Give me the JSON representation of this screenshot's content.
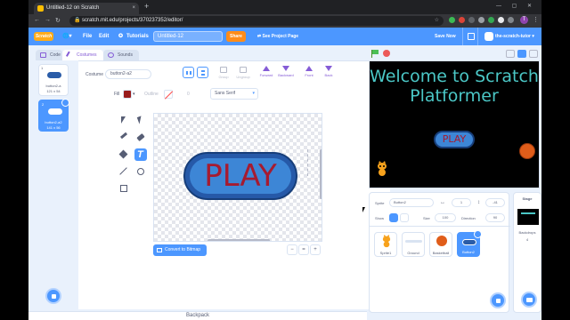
{
  "browser": {
    "tab_title": "Untitled-12 on Scratch",
    "tab_close": "×",
    "new_tab": "+",
    "url": "scratch.mit.edu/projects/370237352/editor/",
    "profile_initial": "T"
  },
  "menubar": {
    "logo": "Scratch",
    "file": "File",
    "edit": "Edit",
    "tutorials": "Tutorials",
    "project_title": "Untitled-12",
    "share": "Share",
    "see_project_page": "See Project Page",
    "save_now": "Save Now",
    "username": "the-scratch-tutor"
  },
  "editor_tabs": {
    "code": "Code",
    "costumes": "Costumes",
    "sounds": "Sounds"
  },
  "costumes": [
    {
      "number": "1",
      "name": "button2-a",
      "size": "121 x 54"
    },
    {
      "number": "2",
      "name": "button2-a2",
      "size": "141 x 56"
    }
  ],
  "paint": {
    "costume_label": "Costume",
    "costume_name": "button2-a2",
    "tools_top": [
      {
        "label": "Group"
      },
      {
        "label": "Ungroup"
      },
      {
        "label": "Forward"
      },
      {
        "label": "Backward"
      },
      {
        "label": "Front"
      },
      {
        "label": "Back"
      }
    ],
    "fill_label": "Fill",
    "fill_color": "#991c1c",
    "outline_label": "Outline",
    "outline_value": "0",
    "font": "Sans Serif",
    "canvas_text": "PLAY",
    "convert_button": "Convert to Bitmap",
    "zoom_out": "−",
    "zoom_reset": "=",
    "zoom_in": "+"
  },
  "stage": {
    "title_line1": "Welcome to Scratch",
    "title_line2": "Platformer",
    "play_label": "PLAY",
    "title_color": "#4bc7c6"
  },
  "sprite_info": {
    "sprite_label": "Sprite",
    "sprite_name": "Button2",
    "x_label": "↔",
    "x_value": "1",
    "y_label": "↕",
    "y_value": "-41",
    "show_label": "Show",
    "size_label": "Size",
    "size_value": "100",
    "direction_label": "Direction",
    "direction_value": "90"
  },
  "sprites": [
    {
      "name": "Sprite1"
    },
    {
      "name": "Ground"
    },
    {
      "name": "Basketball"
    },
    {
      "name": "Button2"
    }
  ],
  "stage_pane": {
    "header": "Stage",
    "backdrops_label": "Backdrops",
    "backdrops_count": "4"
  },
  "backpack": "Backpack",
  "colors": {
    "scratch_blue": "#4c97ff",
    "share_orange": "#ff8c1a",
    "play_red": "#a61b30"
  }
}
